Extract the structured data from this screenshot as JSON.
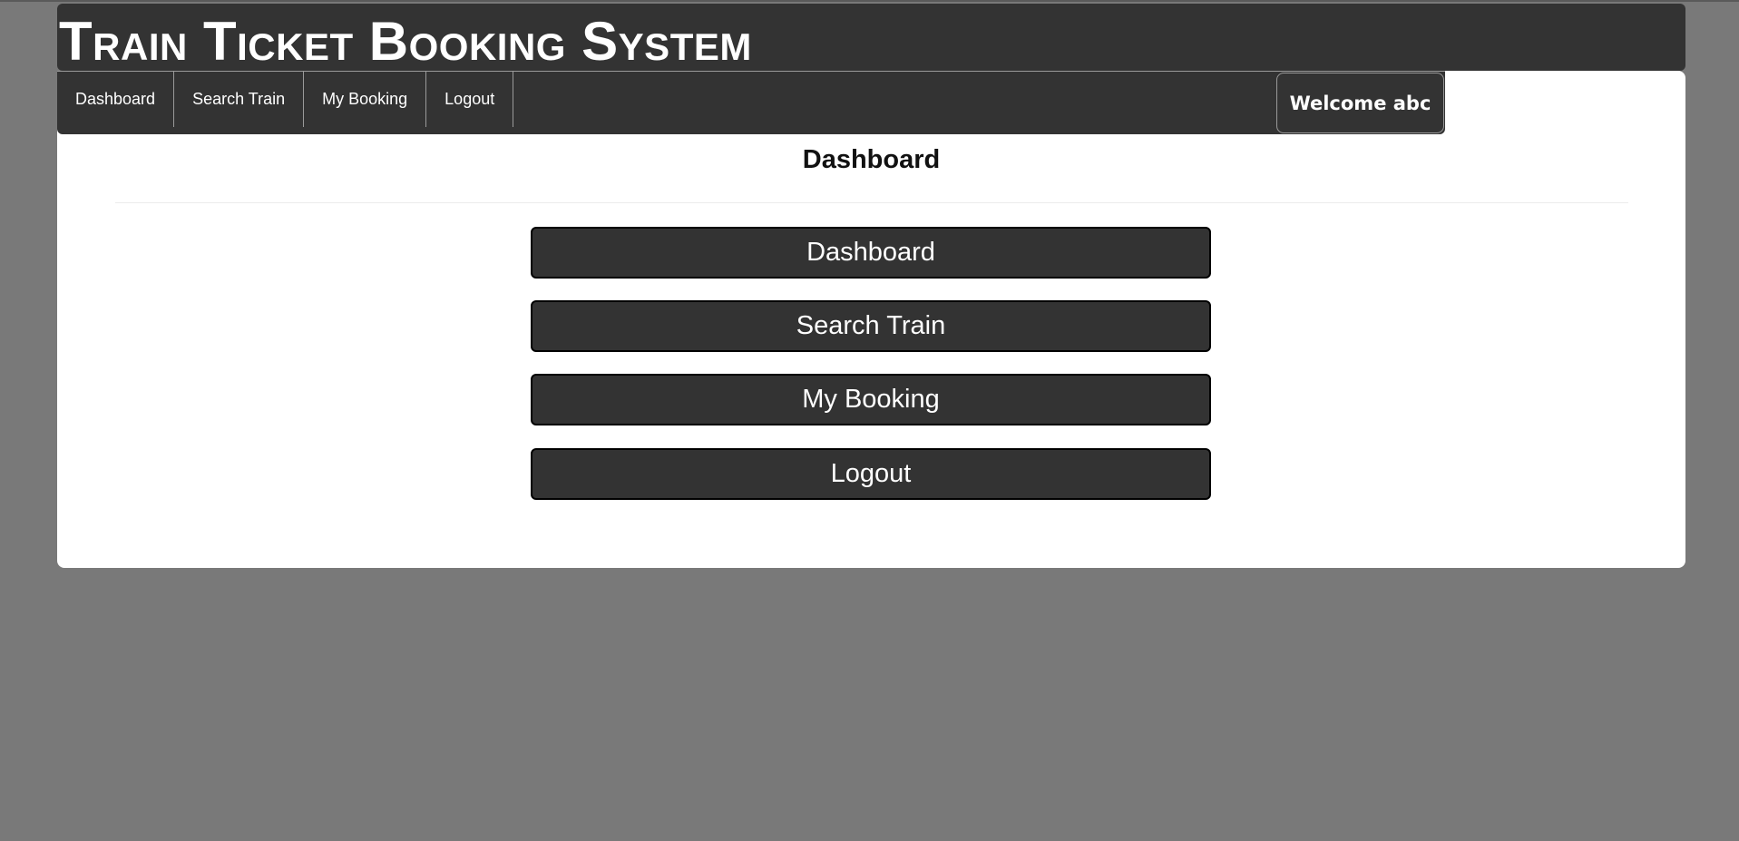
{
  "header": {
    "title": "Train Ticket Booking System"
  },
  "navbar": {
    "items": [
      {
        "label": "Dashboard"
      },
      {
        "label": "Search Train"
      },
      {
        "label": "My Booking"
      },
      {
        "label": "Logout"
      }
    ],
    "welcome": "Welcome abc"
  },
  "main": {
    "title": "Dashboard",
    "buttons": [
      {
        "label": "Dashboard"
      },
      {
        "label": "Search Train"
      },
      {
        "label": "My Booking"
      },
      {
        "label": "Logout"
      }
    ]
  },
  "colors": {
    "page_background": "#797979",
    "bar_background": "#333333",
    "card_background": "#ffffff",
    "text_light": "#ffffff"
  }
}
